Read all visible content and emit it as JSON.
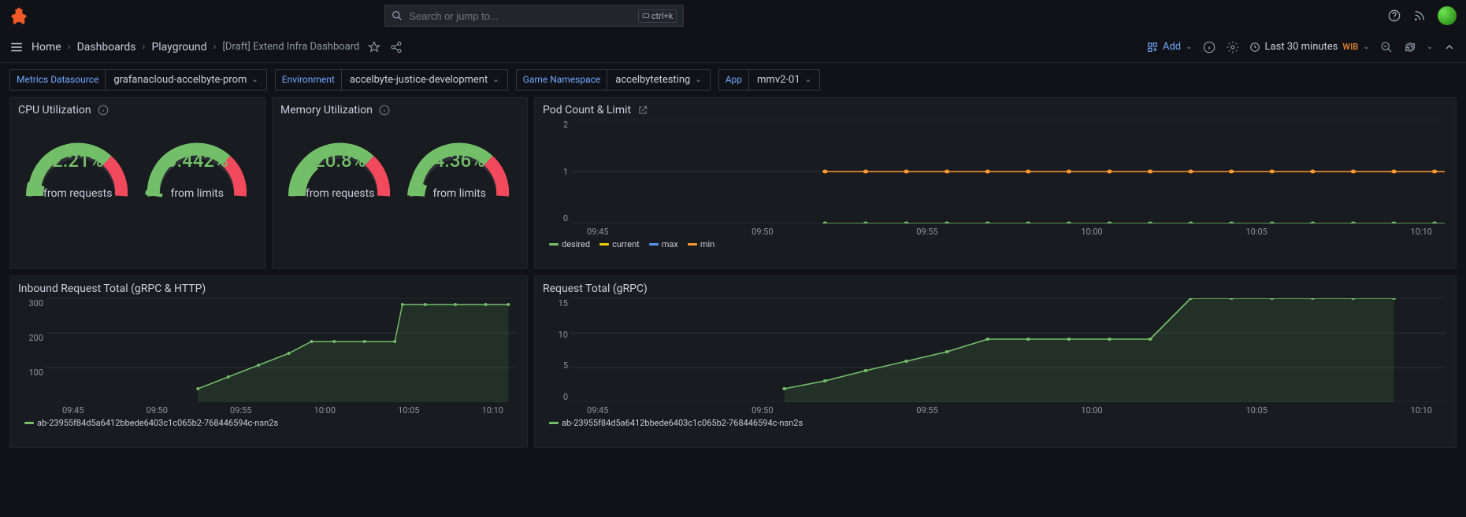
{
  "search": {
    "placeholder": "Search or jump to...",
    "shortcut": "ctrl+k"
  },
  "breadcrumbs": {
    "home": "Home",
    "dash": "Dashboards",
    "play": "Playground",
    "current": "[Draft] Extend Infra Dashboard"
  },
  "toolbar": {
    "add": "Add",
    "timerange": "Last 30 minutes",
    "tz": "WIB"
  },
  "vars": {
    "ds_label": "Metrics Datasource",
    "ds_value": "grafanacloud-accelbyte-prom",
    "env_label": "Environment",
    "env_value": "accelbyte-justice-development",
    "ns_label": "Game Namespace",
    "ns_value": "accelbytetesting",
    "app_label": "App",
    "app_value": "mmv2-01"
  },
  "panels": {
    "cpu": {
      "title": "CPU Utilization",
      "req_val": "2.21%",
      "lim_val": "0.442%",
      "req_lbl": "from requests",
      "lim_lbl": "from limits"
    },
    "mem": {
      "title": "Memory Utilization",
      "req_val": "20.8%",
      "lim_val": "4.36%",
      "req_lbl": "from requests",
      "lim_lbl": "from limits"
    },
    "pods": {
      "title": "Pod Count & Limit",
      "legend": {
        "desired": "desired",
        "current": "current",
        "max": "max",
        "min": "min"
      }
    },
    "inbound": {
      "title": "Inbound Request Total (gRPC & HTTP)",
      "series": "ab-23955f84d5a6412bbede6403c1c065b2-768446594c-nsn2s"
    },
    "grpc": {
      "title": "Request Total (gRPC)",
      "series": "ab-23955f84d5a6412bbede6403c1c065b2-768446594c-nsn2s"
    }
  },
  "x_ticks": [
    "09:45",
    "09:50",
    "09:55",
    "10:00",
    "10:05",
    "10:10"
  ],
  "chart_data": [
    {
      "type": "line",
      "title": "Pod Count & Limit",
      "x": [
        "09:45",
        "09:50",
        "09:55",
        "10:00",
        "10:05",
        "10:10"
      ],
      "ylim": [
        0,
        2
      ],
      "y_ticks": [
        0,
        1,
        2
      ],
      "series": [
        {
          "name": "desired",
          "color": "#73bf69",
          "values": [
            null,
            null,
            0,
            0,
            0,
            0
          ]
        },
        {
          "name": "current",
          "color": "#f2cc0c",
          "values": [
            null,
            null,
            0,
            0,
            0,
            0
          ]
        },
        {
          "name": "max",
          "color": "#5794f2",
          "values": [
            null,
            null,
            0,
            0,
            0,
            0
          ]
        },
        {
          "name": "min",
          "color": "#ff9830",
          "values": [
            null,
            null,
            1,
            1,
            1,
            1
          ]
        }
      ]
    },
    {
      "type": "area",
      "title": "Inbound Request Total (gRPC & HTTP)",
      "x": [
        "09:45",
        "09:50",
        "09:55",
        "10:00",
        "10:05",
        "10:10"
      ],
      "ylim": [
        0,
        300
      ],
      "y_ticks": [
        100,
        200,
        300
      ],
      "series": [
        {
          "name": "ab-23955f84d5a6412bbede6403c1c065b2-768446594c-nsn2s",
          "color": "#73bf69",
          "values": [
            null,
            40,
            120,
            175,
            285,
            285
          ]
        }
      ]
    },
    {
      "type": "area",
      "title": "Request Total (gRPC)",
      "x": [
        "09:45",
        "09:50",
        "09:55",
        "10:00",
        "10:05",
        "10:10"
      ],
      "ylim": [
        0,
        15
      ],
      "y_ticks": [
        0,
        5,
        10,
        15
      ],
      "series": [
        {
          "name": "ab-23955f84d5a6412bbede6403c1c065b2-768446594c-nsn2s",
          "color": "#73bf69",
          "values": [
            null,
            2,
            6,
            9,
            15,
            15
          ]
        }
      ]
    }
  ]
}
